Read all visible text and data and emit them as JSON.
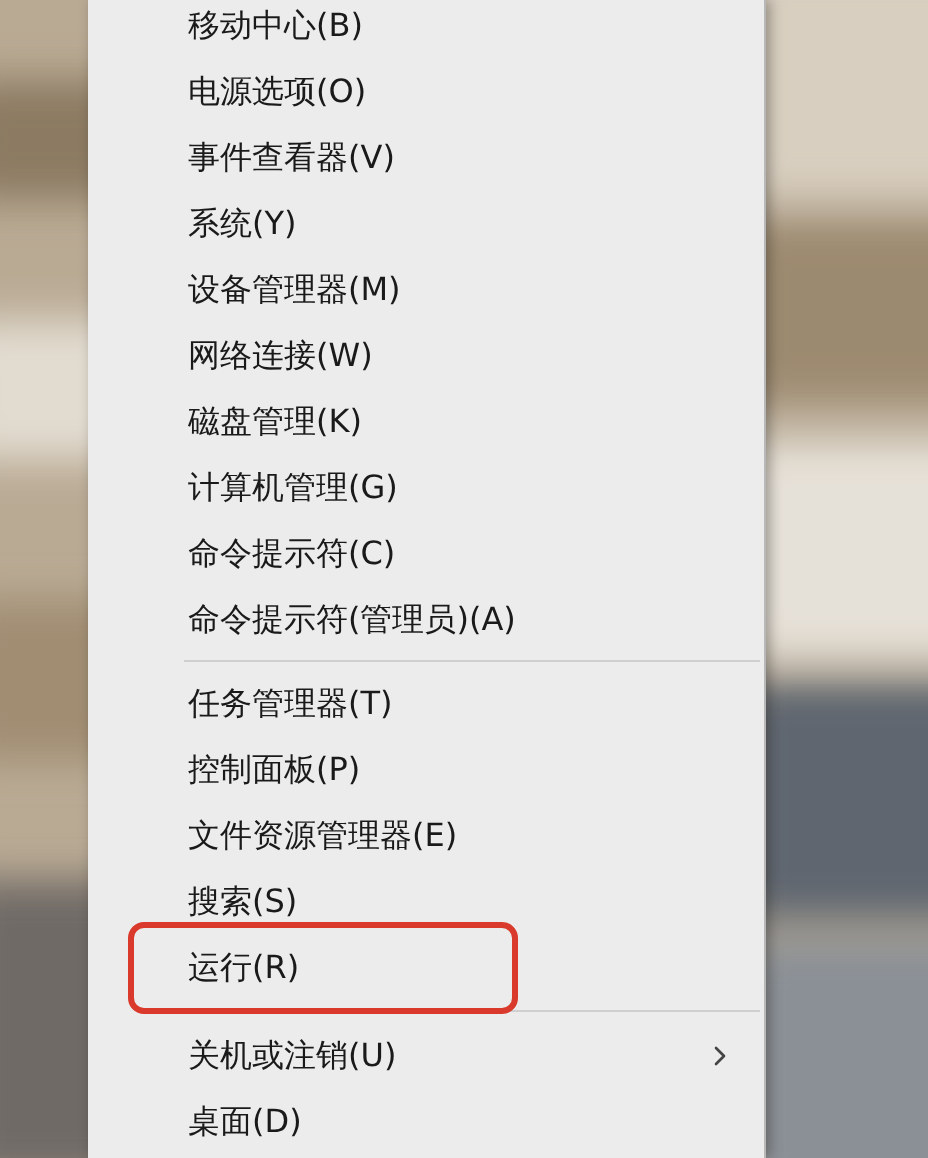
{
  "menu": {
    "groups": [
      {
        "items": [
          {
            "label": "移动中心(B)",
            "has_submenu": false,
            "annotated": false
          },
          {
            "label": "电源选项(O)",
            "has_submenu": false,
            "annotated": false
          },
          {
            "label": "事件查看器(V)",
            "has_submenu": false,
            "annotated": false
          },
          {
            "label": "系统(Y)",
            "has_submenu": false,
            "annotated": false
          },
          {
            "label": "设备管理器(M)",
            "has_submenu": false,
            "annotated": false
          },
          {
            "label": "网络连接(W)",
            "has_submenu": false,
            "annotated": false
          },
          {
            "label": "磁盘管理(K)",
            "has_submenu": false,
            "annotated": false
          },
          {
            "label": "计算机管理(G)",
            "has_submenu": false,
            "annotated": false
          },
          {
            "label": "命令提示符(C)",
            "has_submenu": false,
            "annotated": false
          },
          {
            "label": "命令提示符(管理员)(A)",
            "has_submenu": false,
            "annotated": false
          }
        ]
      },
      {
        "items": [
          {
            "label": "任务管理器(T)",
            "has_submenu": false,
            "annotated": false
          },
          {
            "label": "控制面板(P)",
            "has_submenu": false,
            "annotated": false
          },
          {
            "label": "文件资源管理器(E)",
            "has_submenu": false,
            "annotated": false
          },
          {
            "label": "搜索(S)",
            "has_submenu": false,
            "annotated": false
          },
          {
            "label": "运行(R)",
            "has_submenu": false,
            "annotated": true
          }
        ]
      },
      {
        "items": [
          {
            "label": "关机或注销(U)",
            "has_submenu": true,
            "annotated": false
          },
          {
            "label": "桌面(D)",
            "has_submenu": false,
            "annotated": false
          }
        ]
      }
    ]
  }
}
